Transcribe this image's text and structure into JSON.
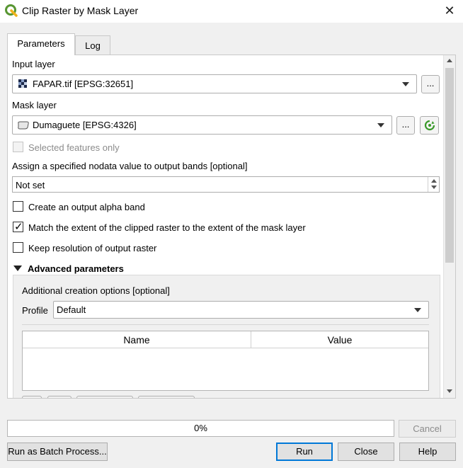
{
  "window": {
    "title": "Clip Raster by Mask Layer",
    "close_glyph": "✕"
  },
  "tabs": [
    {
      "label": "Parameters",
      "active": true
    },
    {
      "label": "Log",
      "active": false
    }
  ],
  "params": {
    "input_layer": {
      "label": "Input layer",
      "value": "FAPAR.tif [EPSG:32651]",
      "browse": "..."
    },
    "mask_layer": {
      "label": "Mask layer",
      "value": "Dumaguete [EPSG:4326]",
      "browse": "..."
    },
    "selected_only": {
      "label": "Selected features only",
      "checked": false,
      "enabled": false
    },
    "nodata": {
      "label": "Assign a specified nodata value to output bands [optional]",
      "value": "Not set"
    },
    "alpha_band": {
      "label": "Create an output alpha band",
      "checked": false
    },
    "match_extent": {
      "label": "Match the extent of the clipped raster to the extent of the mask layer",
      "checked": true
    },
    "keep_resolution": {
      "label": "Keep resolution of output raster",
      "checked": false
    }
  },
  "advanced": {
    "header": "Advanced parameters",
    "creation_options_label": "Additional creation options [optional]",
    "profile_label": "Profile",
    "profile_value": "Default",
    "table_columns": [
      "Name",
      "Value"
    ]
  },
  "progress": {
    "value": 0,
    "text": "0%"
  },
  "buttons": {
    "cancel": "Cancel",
    "batch": "Run as Batch Process...",
    "run": "Run",
    "close": "Close",
    "help": "Help"
  },
  "colors": {
    "accent": "#0078d7",
    "qgis_green": "#589632",
    "progress_fill": "#06b025"
  }
}
